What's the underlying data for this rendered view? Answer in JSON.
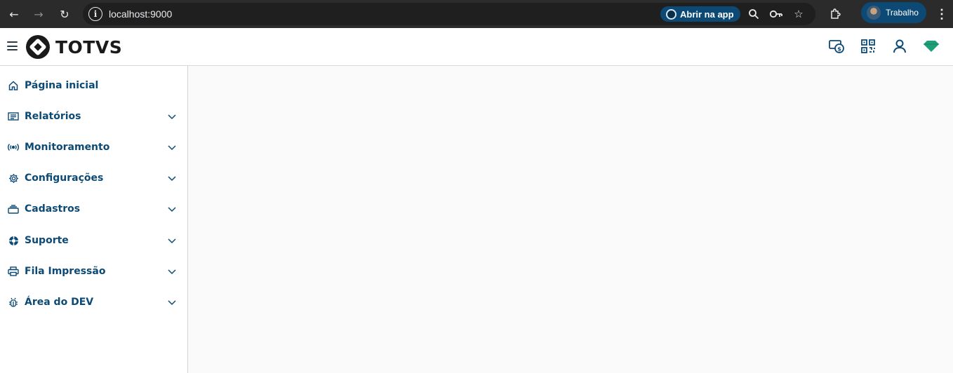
{
  "browser": {
    "url": "localhost:9000",
    "open_app_label": "Abrir na app",
    "profile_label": "Trabalho"
  },
  "header": {
    "brand_name": "TOTVS",
    "accent_color": "#0c4a75",
    "icons": [
      "payment-icon",
      "qr-code-icon",
      "user-icon",
      "gem-icon"
    ]
  },
  "sidebar": {
    "items": [
      {
        "label": "Página inicial",
        "icon": "home-icon",
        "expandable": false
      },
      {
        "label": "Relatórios",
        "icon": "report-icon",
        "expandable": true
      },
      {
        "label": "Monitoramento",
        "icon": "broadcast-icon",
        "expandable": true
      },
      {
        "label": "Configurações",
        "icon": "gear-icon",
        "expandable": true
      },
      {
        "label": "Cadastros",
        "icon": "tray-icon",
        "expandable": true
      },
      {
        "label": "Suporte",
        "icon": "lifebuoy-icon",
        "expandable": true
      },
      {
        "label": "Fila Impressão",
        "icon": "printer-icon",
        "expandable": true
      },
      {
        "label": "Área do DEV",
        "icon": "bug-icon",
        "expandable": true
      }
    ]
  }
}
